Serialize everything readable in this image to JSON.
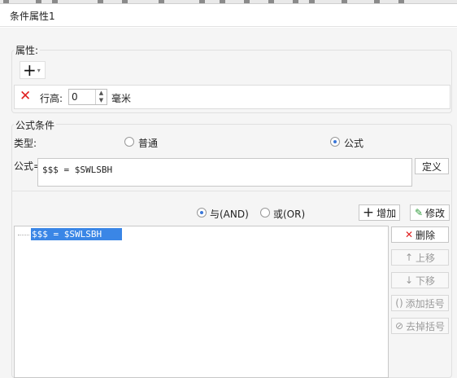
{
  "window": {
    "title": "条件属性1"
  },
  "properties": {
    "group_label": "属性:",
    "add_symbol": "+",
    "add_caret": "▾",
    "row_height_label": "行高:",
    "row_height_value": "0",
    "unit": "毫米"
  },
  "formula_condition": {
    "group_label": "公式条件",
    "type_label": "类型:",
    "option_normal": "普通",
    "option_formula": "公式",
    "selected_type": "公式",
    "formula_label": "公式=",
    "formula_value": "$$$ = $SWLSBH",
    "define_button": "定义"
  },
  "logic": {
    "and_label": "与(AND)",
    "or_label": "或(OR)",
    "selected": "与(AND)",
    "add_button": "增加",
    "edit_button": "修改"
  },
  "condition_list": {
    "items": [
      "$$$ = $SWLSBH"
    ]
  },
  "side_buttons": {
    "delete": "删除",
    "move_up": "上移",
    "move_down": "下移",
    "add_bracket": "添加括号",
    "remove_bracket": "去掉括号"
  },
  "colors": {
    "accent": "#3a86e6",
    "delete_red": "#e02020",
    "edit_green": "#2e9a3a"
  }
}
